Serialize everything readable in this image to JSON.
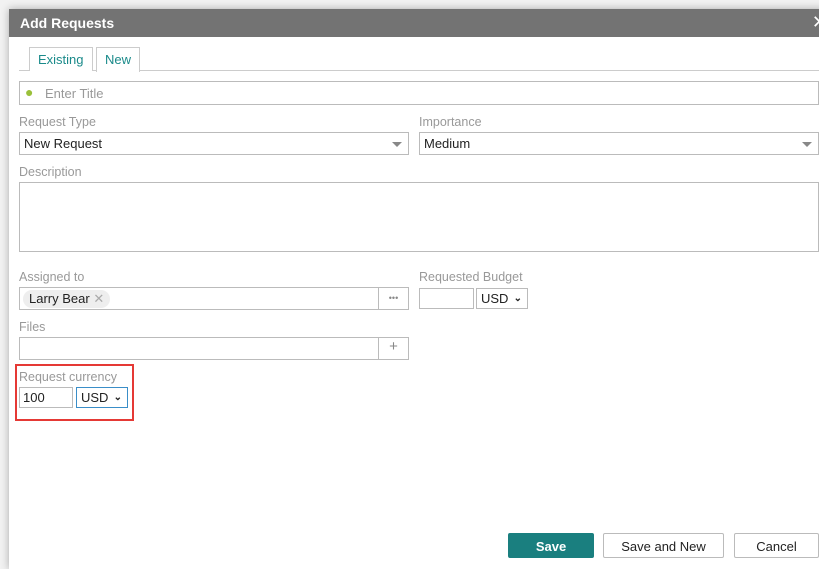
{
  "dialog": {
    "title": "Add Requests"
  },
  "tabs": [
    {
      "label": "Existing"
    },
    {
      "label": "New"
    }
  ],
  "title_field": {
    "placeholder": "Enter Title"
  },
  "request_type": {
    "label": "Request Type",
    "value": "New Request"
  },
  "importance": {
    "label": "Importance",
    "value": "Medium"
  },
  "description": {
    "label": "Description",
    "value": ""
  },
  "assigned_to": {
    "label": "Assigned to",
    "chip": "Larry Bear",
    "more": "•••"
  },
  "requested_budget": {
    "label": "Requested Budget",
    "value": "",
    "currency": "USD"
  },
  "files": {
    "label": "Files",
    "add": "+"
  },
  "request_currency": {
    "label": "Request currency",
    "value": "100",
    "currency": "USD"
  },
  "buttons": {
    "save": "Save",
    "save_new": "Save and New",
    "cancel": "Cancel"
  },
  "colors": {
    "accent": "#1a7f7f",
    "highlight": "#e53935",
    "header": "#737373"
  }
}
